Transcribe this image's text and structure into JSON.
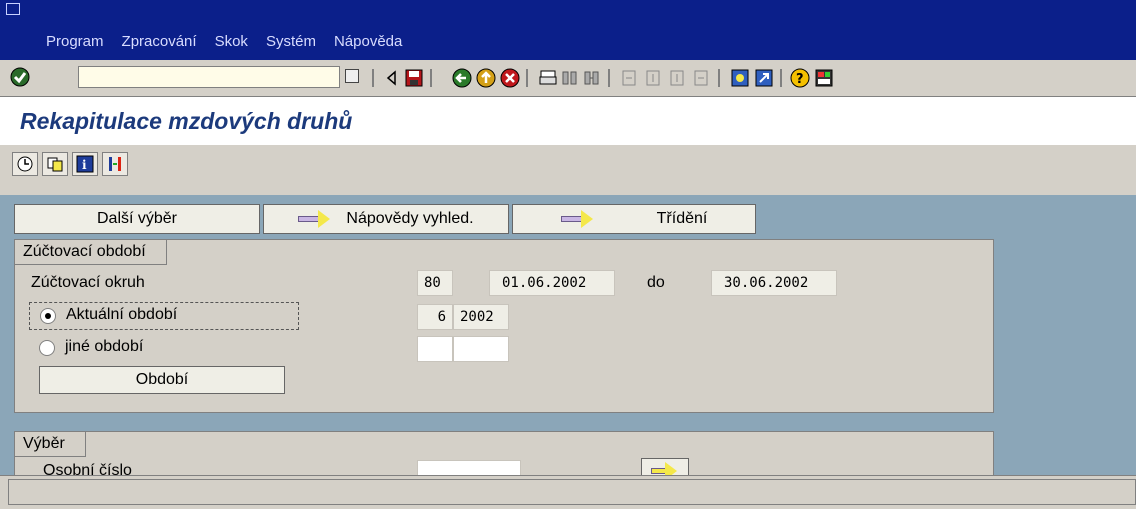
{
  "menu": {
    "items": [
      "Program",
      "Zpracování",
      "Skok",
      "Systém",
      "Nápověda"
    ]
  },
  "toolbar": {
    "command_field_value": "",
    "icons": [
      "enter-icon",
      "save-icon",
      "back-icon",
      "exit-icon",
      "cancel-icon",
      "print-icon",
      "find-icon",
      "find-next-icon",
      "first-page-icon",
      "previous-page-icon",
      "next-page-icon",
      "last-page-icon",
      "create-session-icon",
      "shortcut-icon",
      "help-icon",
      "layout-icon"
    ]
  },
  "title": "Rekapitulace mzdových druhů",
  "app_toolbar": {
    "icons": [
      "execute-icon",
      "get-variant-icon",
      "info-icon",
      "selection-options-icon"
    ]
  },
  "buttons": {
    "dalsi_vyber": "Další výběr",
    "napovedy_vyhled": "Nápovědy vyhled.",
    "trideni": "Třídění"
  },
  "period_group": {
    "title": "Zúčtovací období",
    "okruh_label": "Zúčtovací okruh",
    "okruh_value": "80",
    "date_from": "01.06.2002",
    "do_label": "do",
    "date_to": "30.06.2002",
    "current_label": "Aktuální období",
    "current_period": "6",
    "current_year": "2002",
    "other_label": "jiné období",
    "other_period": "",
    "other_year": "",
    "obdobi_button": "Období",
    "selected": "current"
  },
  "selection_group": {
    "title": "Výběr",
    "first_label_partial": "Osobní číslo"
  },
  "status": {
    "text": ""
  }
}
